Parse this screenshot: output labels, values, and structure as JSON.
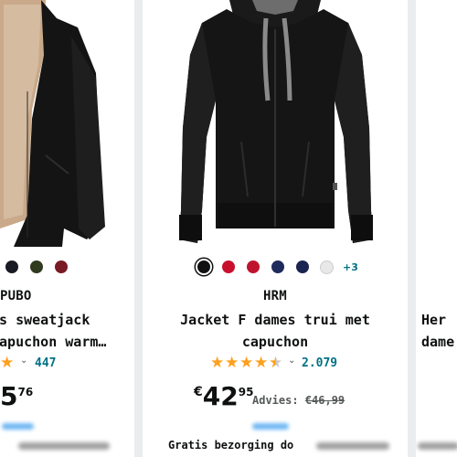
{
  "products": [
    {
      "brand": "PUBO",
      "title_line1": "es sweatjack",
      "title_line2": "capuchon warm…",
      "review_count": "447",
      "price_main": "5",
      "price_cents": "76"
    },
    {
      "brand": "HRM",
      "title_line1": "Jacket F dames trui met",
      "title_line2": "capuchon",
      "review_count": "2.079",
      "price_currency": "€",
      "price_main": "42",
      "price_cents": "95",
      "advies_label": "Advies:",
      "advies_price": "€46,99",
      "more_colors": "+3",
      "delivery": "Gratis bezorging do",
      "rating": 4.5
    },
    {
      "title_line1": "Her",
      "title_line2": "dame"
    }
  ],
  "colors": {
    "link": "#007185",
    "star": "#ff9f1c",
    "swatches_left": [
      "#1a1a24",
      "#2f3a1e",
      "#7a1a24"
    ],
    "swatches_mid": [
      "#111111",
      "#c8102e",
      "#c0132f",
      "#1f2a5c",
      "#1c2452",
      "#e8e8e8"
    ]
  },
  "icons": {
    "star": "star-icon",
    "half_star": "star-half-icon",
    "chevron": "chevron-down-icon"
  }
}
